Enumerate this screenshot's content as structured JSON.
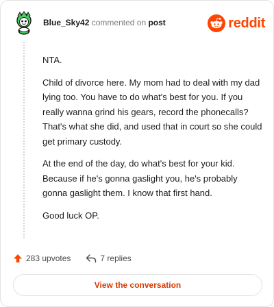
{
  "header": {
    "username": "Blue_Sky42",
    "action_text": "commented on",
    "post_link": "post",
    "logo_word": "reddit",
    "avatar_icon": "snoo-avatar-icon",
    "logo_icon": "reddit-snoo-logo-icon"
  },
  "comment": {
    "paragraphs": [
      "NTA.",
      "Child of divorce here. My mom had to deal with my dad lying too. You have to do what's best for you. If you really wanna grind his gears, record the phonecalls? That's what she did, and used that in court so she could get primary custody.",
      "At the end of the day, do what's best for your kid. Because if he's gonna gaslight you, he's probably gonna gaslight them. I know that first hand.",
      "Good luck OP."
    ]
  },
  "footer": {
    "upvotes": "283 upvotes",
    "replies": "7 replies",
    "upvote_icon": "upvote-arrow-icon",
    "reply_icon": "reply-arrow-icon"
  },
  "cta": {
    "label": "View the conversation"
  },
  "colors": {
    "brand": "#ff4500",
    "cta_text": "#d93900",
    "avatar_green": "#46d160",
    "border": "#e3e3e3"
  }
}
